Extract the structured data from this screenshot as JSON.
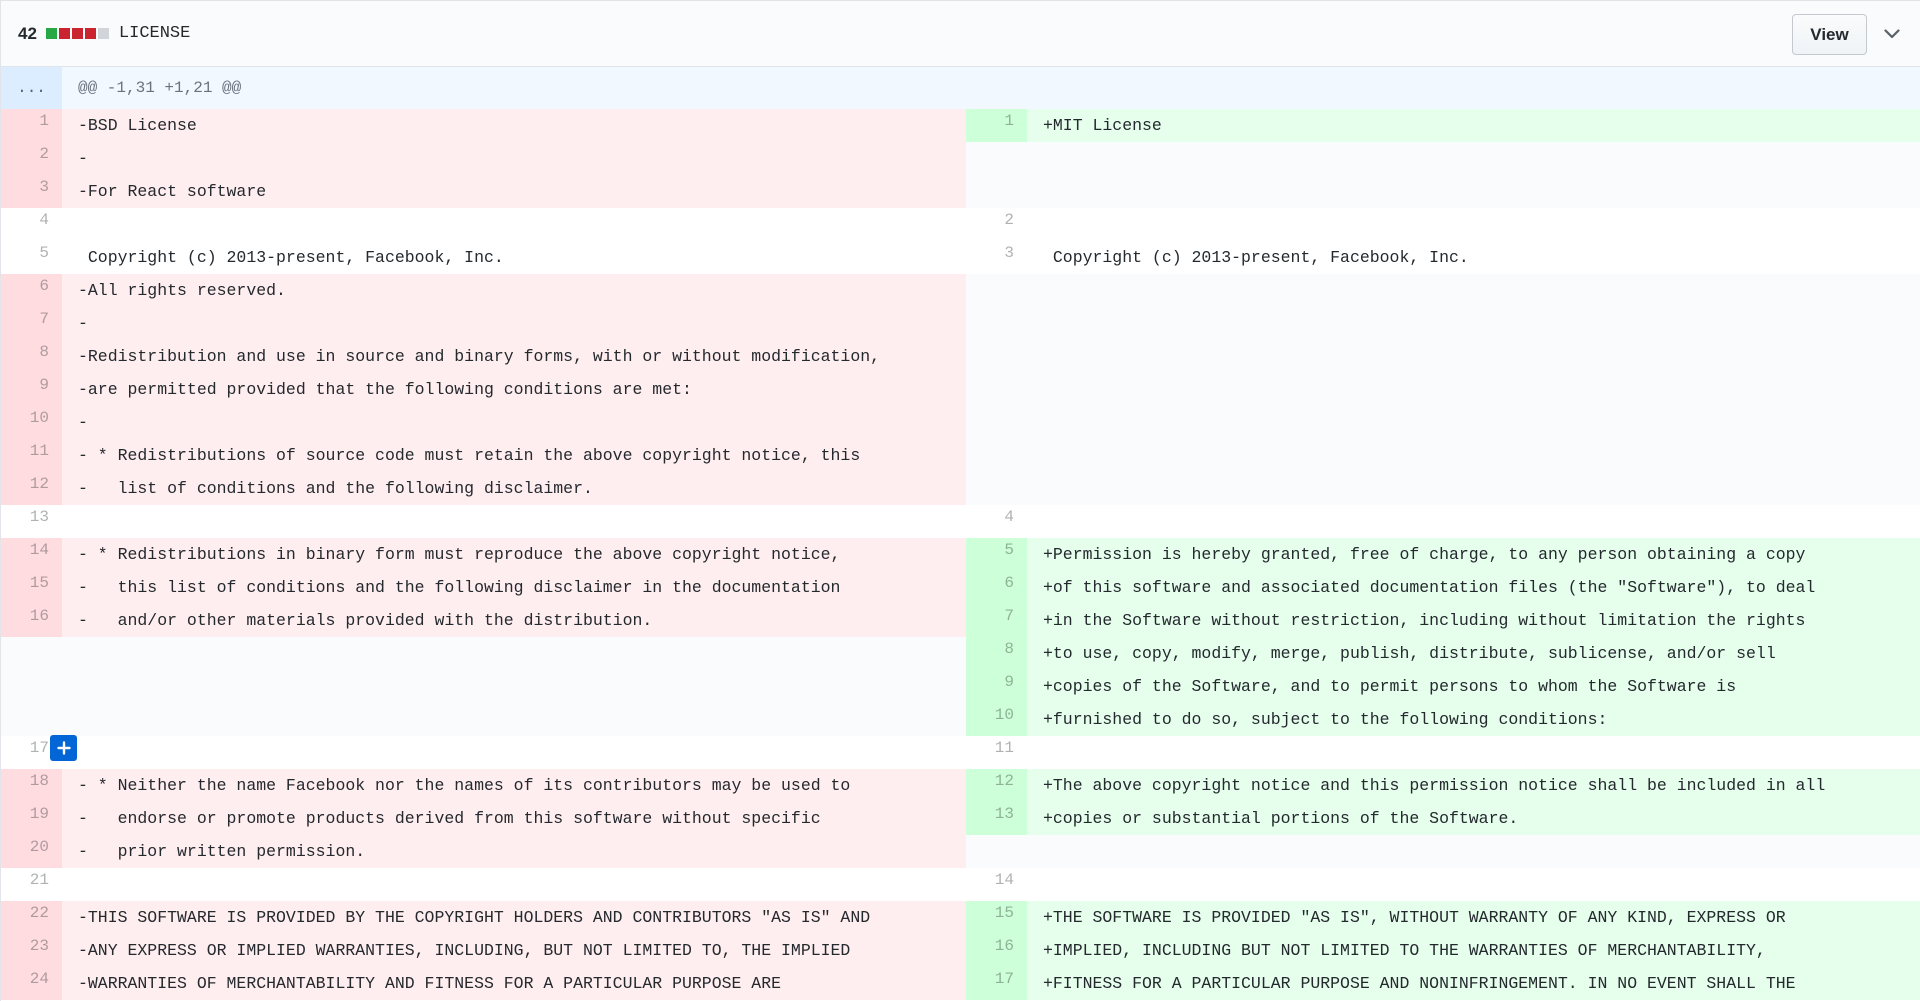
{
  "file": {
    "additions_deletions_count": "42",
    "diffstat_colors": [
      "#28a745",
      "#cb2431",
      "#cb2431",
      "#cb2431",
      "#d1d5da"
    ],
    "name": "LICENSE",
    "view_label": "View",
    "toggle_icon": "chevron-down-icon"
  },
  "hunk": {
    "expander_label": "...",
    "header": "@@ -1,31 +1,21 @@"
  },
  "colors": {
    "del_bg": "#ffeef0",
    "del_num_bg": "#ffdce0",
    "add_bg": "#e6ffed",
    "add_num_bg": "#cdffd8",
    "empty_bg": "#fafbfc",
    "ctx_bg": "#ffffff",
    "accent": "#0366d6"
  },
  "rows": [
    {
      "left": {
        "num": "1",
        "text": "-BSD License",
        "type": "del"
      },
      "right": {
        "num": "1",
        "text": "+MIT License",
        "type": "add"
      }
    },
    {
      "left": {
        "num": "2",
        "text": "-",
        "type": "del"
      },
      "right": {
        "type": "empty"
      }
    },
    {
      "left": {
        "num": "3",
        "text": "-For React software",
        "type": "del"
      },
      "right": {
        "type": "empty"
      }
    },
    {
      "left": {
        "num": "4",
        "text": " ",
        "type": "ctx"
      },
      "right": {
        "num": "2",
        "text": " ",
        "type": "ctx"
      }
    },
    {
      "left": {
        "num": "5",
        "text": " Copyright (c) 2013-present, Facebook, Inc.",
        "type": "ctx"
      },
      "right": {
        "num": "3",
        "text": " Copyright (c) 2013-present, Facebook, Inc.",
        "type": "ctx"
      }
    },
    {
      "left": {
        "num": "6",
        "text": "-All rights reserved.",
        "type": "del"
      },
      "right": {
        "type": "empty"
      }
    },
    {
      "left": {
        "num": "7",
        "text": "-",
        "type": "del"
      },
      "right": {
        "type": "empty"
      }
    },
    {
      "left": {
        "num": "8",
        "text": "-Redistribution and use in source and binary forms, with or without modification,",
        "type": "del"
      },
      "right": {
        "type": "empty"
      }
    },
    {
      "left": {
        "num": "9",
        "text": "-are permitted provided that the following conditions are met:",
        "type": "del"
      },
      "right": {
        "type": "empty"
      }
    },
    {
      "left": {
        "num": "10",
        "text": "-",
        "type": "del"
      },
      "right": {
        "type": "empty"
      }
    },
    {
      "left": {
        "num": "11",
        "text": "- * Redistributions of source code must retain the above copyright notice, this",
        "type": "del"
      },
      "right": {
        "type": "empty"
      }
    },
    {
      "left": {
        "num": "12",
        "text": "-   list of conditions and the following disclaimer.",
        "type": "del"
      },
      "right": {
        "type": "empty"
      }
    },
    {
      "left": {
        "num": "13",
        "text": " ",
        "type": "ctx"
      },
      "right": {
        "num": "4",
        "text": " ",
        "type": "ctx"
      }
    },
    {
      "left": {
        "num": "14",
        "text": "- * Redistributions in binary form must reproduce the above copyright notice,",
        "type": "del"
      },
      "right": {
        "num": "5",
        "text": "+Permission is hereby granted, free of charge, to any person obtaining a copy",
        "type": "add"
      }
    },
    {
      "left": {
        "num": "15",
        "text": "-   this list of conditions and the following disclaimer in the documentation",
        "type": "del"
      },
      "right": {
        "num": "6",
        "text": "+of this software and associated documentation files (the \"Software\"), to deal",
        "type": "add"
      }
    },
    {
      "left": {
        "num": "16",
        "text": "-   and/or other materials provided with the distribution.",
        "type": "del"
      },
      "right": {
        "num": "7",
        "text": "+in the Software without restriction, including without limitation the rights",
        "type": "add"
      }
    },
    {
      "left": {
        "type": "empty"
      },
      "right": {
        "num": "8",
        "text": "+to use, copy, modify, merge, publish, distribute, sublicense, and/or sell",
        "type": "add"
      }
    },
    {
      "left": {
        "type": "empty"
      },
      "right": {
        "num": "9",
        "text": "+copies of the Software, and to permit persons to whom the Software is",
        "type": "add"
      }
    },
    {
      "left": {
        "type": "empty"
      },
      "right": {
        "num": "10",
        "text": "+furnished to do so, subject to the following conditions:",
        "type": "add"
      }
    },
    {
      "left": {
        "num": "17",
        "text": " ",
        "type": "ctx"
      },
      "right": {
        "num": "11",
        "text": " ",
        "type": "ctx"
      }
    },
    {
      "left": {
        "num": "18",
        "text": "- * Neither the name Facebook nor the names of its contributors may be used to",
        "type": "del"
      },
      "right": {
        "num": "12",
        "text": "+The above copyright notice and this permission notice shall be included in all",
        "type": "add"
      }
    },
    {
      "left": {
        "num": "19",
        "text": "-   endorse or promote products derived from this software without specific",
        "type": "del"
      },
      "right": {
        "num": "13",
        "text": "+copies or substantial portions of the Software.",
        "type": "add"
      }
    },
    {
      "left": {
        "num": "20",
        "text": "-   prior written permission.",
        "type": "del"
      },
      "right": {
        "type": "empty"
      }
    },
    {
      "left": {
        "num": "21",
        "text": " ",
        "type": "ctx"
      },
      "right": {
        "num": "14",
        "text": " ",
        "type": "ctx"
      }
    },
    {
      "left": {
        "num": "22",
        "text": "-THIS SOFTWARE IS PROVIDED BY THE COPYRIGHT HOLDERS AND CONTRIBUTORS \"AS IS\" AND",
        "type": "del"
      },
      "right": {
        "num": "15",
        "text": "+THE SOFTWARE IS PROVIDED \"AS IS\", WITHOUT WARRANTY OF ANY KIND, EXPRESS OR",
        "type": "add"
      }
    },
    {
      "left": {
        "num": "23",
        "text": "-ANY EXPRESS OR IMPLIED WARRANTIES, INCLUDING, BUT NOT LIMITED TO, THE IMPLIED",
        "type": "del"
      },
      "right": {
        "num": "16",
        "text": "+IMPLIED, INCLUDING BUT NOT LIMITED TO THE WARRANTIES OF MERCHANTABILITY,",
        "type": "add"
      }
    },
    {
      "left": {
        "num": "24",
        "text": "-WARRANTIES OF MERCHANTABILITY AND FITNESS FOR A PARTICULAR PURPOSE ARE",
        "type": "del"
      },
      "right": {
        "num": "17",
        "text": "+FITNESS FOR A PARTICULAR PURPOSE AND NONINFRINGEMENT. IN NO EVENT SHALL THE",
        "type": "add"
      }
    }
  ],
  "add_comment_icon": "plus-icon"
}
